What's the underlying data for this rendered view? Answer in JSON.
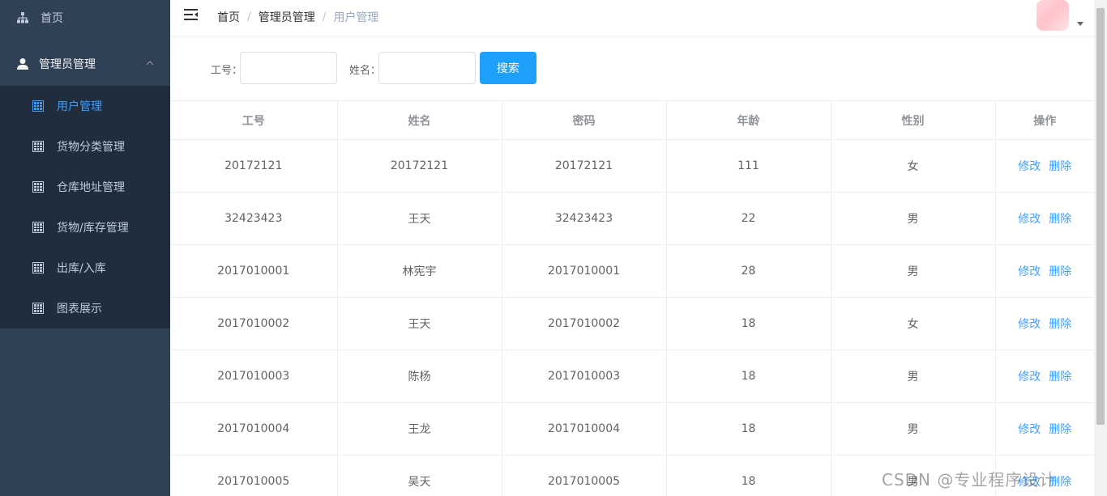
{
  "sidebar": {
    "home_label": "首页",
    "admin_label": "管理员管理",
    "items": [
      {
        "label": "用户管理",
        "active": true
      },
      {
        "label": "货物分类管理",
        "active": false
      },
      {
        "label": "仓库地址管理",
        "active": false
      },
      {
        "label": "货物/库存管理",
        "active": false
      },
      {
        "label": "出库/入库",
        "active": false
      },
      {
        "label": "图表展示",
        "active": false
      }
    ]
  },
  "header": {
    "breadcrumb": [
      "首页",
      "管理员管理",
      "用户管理"
    ],
    "separator": "/"
  },
  "search": {
    "id_label": "工号：",
    "name_label": "姓名：",
    "id_value": "",
    "name_value": "",
    "button_label": "搜索"
  },
  "table": {
    "columns": [
      "工号",
      "姓名",
      "密码",
      "年龄",
      "性别",
      "操作"
    ],
    "edit_label": "修改",
    "delete_label": "删除",
    "rows": [
      [
        "20172121",
        "20172121",
        "20172121",
        "111",
        "女"
      ],
      [
        "32423423",
        "王天",
        "32423423",
        "22",
        "男"
      ],
      [
        "2017010001",
        "林宪宇",
        "2017010001",
        "28",
        "男"
      ],
      [
        "2017010002",
        "王天",
        "2017010002",
        "18",
        "女"
      ],
      [
        "2017010003",
        "陈杨",
        "2017010003",
        "18",
        "男"
      ],
      [
        "2017010004",
        "王龙",
        "2017010004",
        "18",
        "男"
      ],
      [
        "2017010005",
        "吴天",
        "2017010005",
        "18",
        "男"
      ]
    ]
  },
  "watermark": "CSDN @专业程序设计",
  "colors": {
    "sidebar_bg": "#304156",
    "submenu_bg": "#1f2d3d",
    "active": "#409eff",
    "search_button": "#1ea0fa"
  }
}
